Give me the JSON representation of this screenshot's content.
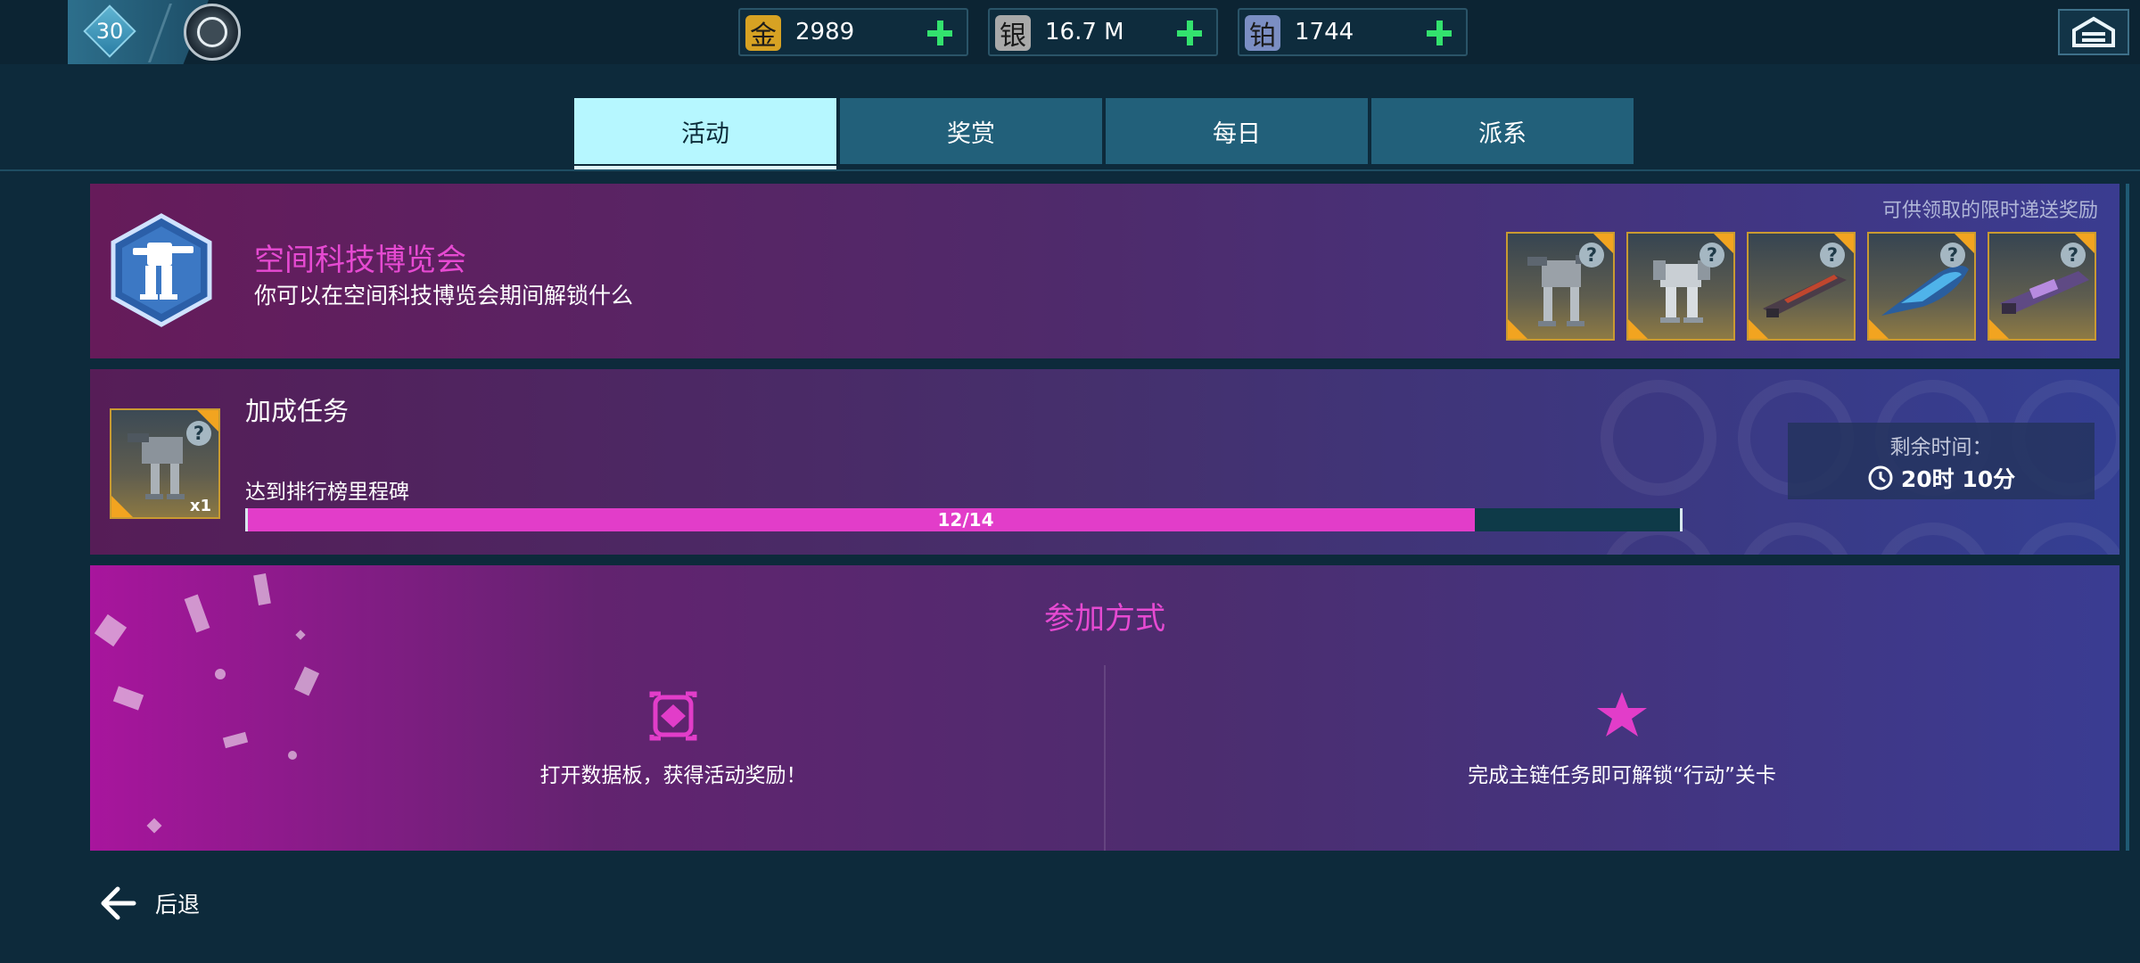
{
  "topbar": {
    "level": "30",
    "currencies": [
      {
        "icon_char": "金",
        "value": "2989",
        "color": "#d7a223"
      },
      {
        "icon_char": "银",
        "value": "16.7 M",
        "color": "#a9a9a9"
      },
      {
        "icon_char": "铂",
        "value": "1744",
        "color": "#7b8ec3"
      }
    ]
  },
  "tabs": [
    {
      "label": "活动",
      "active": true
    },
    {
      "label": "奖赏",
      "active": false
    },
    {
      "label": "每日",
      "active": false
    },
    {
      "label": "派系",
      "active": false
    }
  ],
  "event": {
    "title": "空间科技博览会",
    "description": "你可以在空间科技博览会期间解锁什么",
    "rewards_caption": "可供领取的限时递送奖励",
    "rewards": [
      {
        "icon": "robot-mech-icon"
      },
      {
        "icon": "robot-mech-icon"
      },
      {
        "icon": "weapon-icon"
      },
      {
        "icon": "weapon-icon"
      },
      {
        "icon": "weapon-icon"
      }
    ]
  },
  "task": {
    "title": "加成任务",
    "quantity": "x1",
    "objective": "达到排行榜里程碑",
    "progress_text": "12/14",
    "progress": 0.857,
    "timer_label": "剩余时间：",
    "timer_value": "20时 10分"
  },
  "how": {
    "title": "参加方式",
    "items": [
      {
        "icon": "data-pad-icon",
        "text": "打开数据板，获得活动奖励！"
      },
      {
        "icon": "star-icon",
        "text": "完成主链任务即可解锁“行动”关卡"
      }
    ]
  },
  "footer": {
    "back_label": "后退"
  },
  "colors": {
    "accent_pink": "#e64ad2",
    "active_tab": "#b6f7ff",
    "plus_green": "#33e26e",
    "progress": "#e23dc9"
  }
}
